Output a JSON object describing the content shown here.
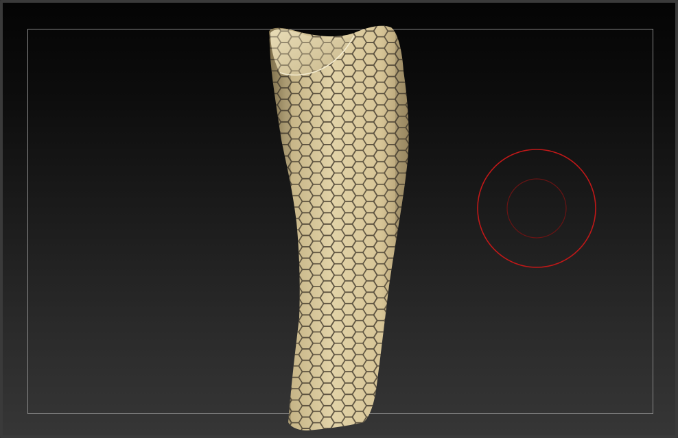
{
  "colors": {
    "background_top": "#040404",
    "background_bottom": "#363636",
    "frame_border": "#8a8a8a",
    "mesh_surface": "#ddcda0",
    "mesh_shadow": "#a8966a",
    "hex_lines": "#4e4535",
    "brush_cursor": "#c01818",
    "brush_cursor_inner": "#6a1414"
  },
  "model": {
    "name": "prosthetic-leg-cover",
    "pattern": "hexagonal-mesh"
  },
  "brush_cursor": {
    "icon": "brush-radius-circle"
  }
}
